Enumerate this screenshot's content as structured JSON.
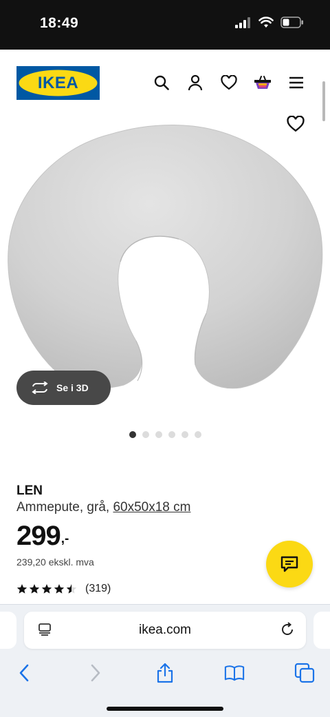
{
  "status_bar": {
    "time": "18:49"
  },
  "header": {
    "logo_text": "IKEA",
    "icons": [
      "search-icon",
      "user-icon",
      "heart-icon",
      "basket-icon",
      "menu-icon"
    ]
  },
  "gallery": {
    "view_3d_label": "Se i 3D",
    "dot_count": 6,
    "active_dot": 0
  },
  "product": {
    "name": "LEN",
    "description": "Ammepute, grå, ",
    "measurement": "60x50x18 cm",
    "price_integer": "299",
    "price_suffix": ",-",
    "price_ex_vat": "239,20 ekskl. mva",
    "rating_stars": 4.5,
    "rating_max": 5,
    "review_count": "(319)"
  },
  "browser": {
    "url": "ikea.com"
  },
  "colors": {
    "ikea_blue": "#0058a3",
    "ikea_yellow": "#fbd914",
    "pillow": "#d3d3d3"
  }
}
